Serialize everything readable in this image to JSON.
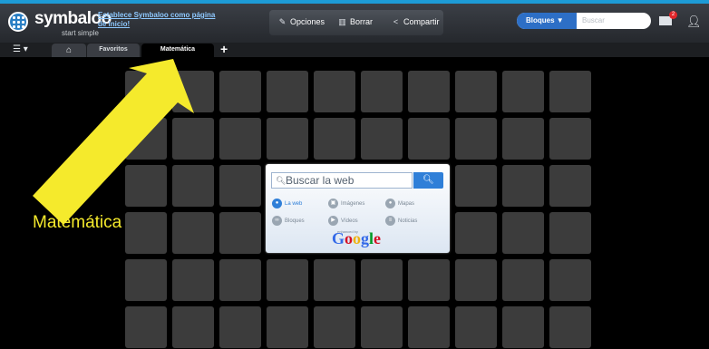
{
  "app": {
    "brand": "symbaloo",
    "tagline": "start simple",
    "homepage_link": "Establece Symbaloo como página de inicio!"
  },
  "toolbar": {
    "opciones": "Opciones",
    "borrar": "Borrar",
    "compartir": "Compartir"
  },
  "search": {
    "scope_label": "Bloques",
    "placeholder": "Buscar"
  },
  "notifications": {
    "count": "2"
  },
  "tabs": {
    "favoritos": "Favoritos",
    "matematica": "Matemática",
    "add": "+"
  },
  "widget": {
    "placeholder": "Buscar la web",
    "options": {
      "la_web": "La web",
      "imagenes": "Imágenes",
      "mapas": "Mapas",
      "bloques": "Bloques",
      "videos": "Vídeos",
      "noticias": "Noticias"
    },
    "enhanced_by": "enhanced by",
    "google": "Google"
  },
  "annotation": {
    "label": "Matemática",
    "arrow_color": "#f5ea2c"
  },
  "colors": {
    "accent": "#1d9bd6",
    "tile": "#3c3c3c",
    "search_button": "#2f7fd8"
  }
}
